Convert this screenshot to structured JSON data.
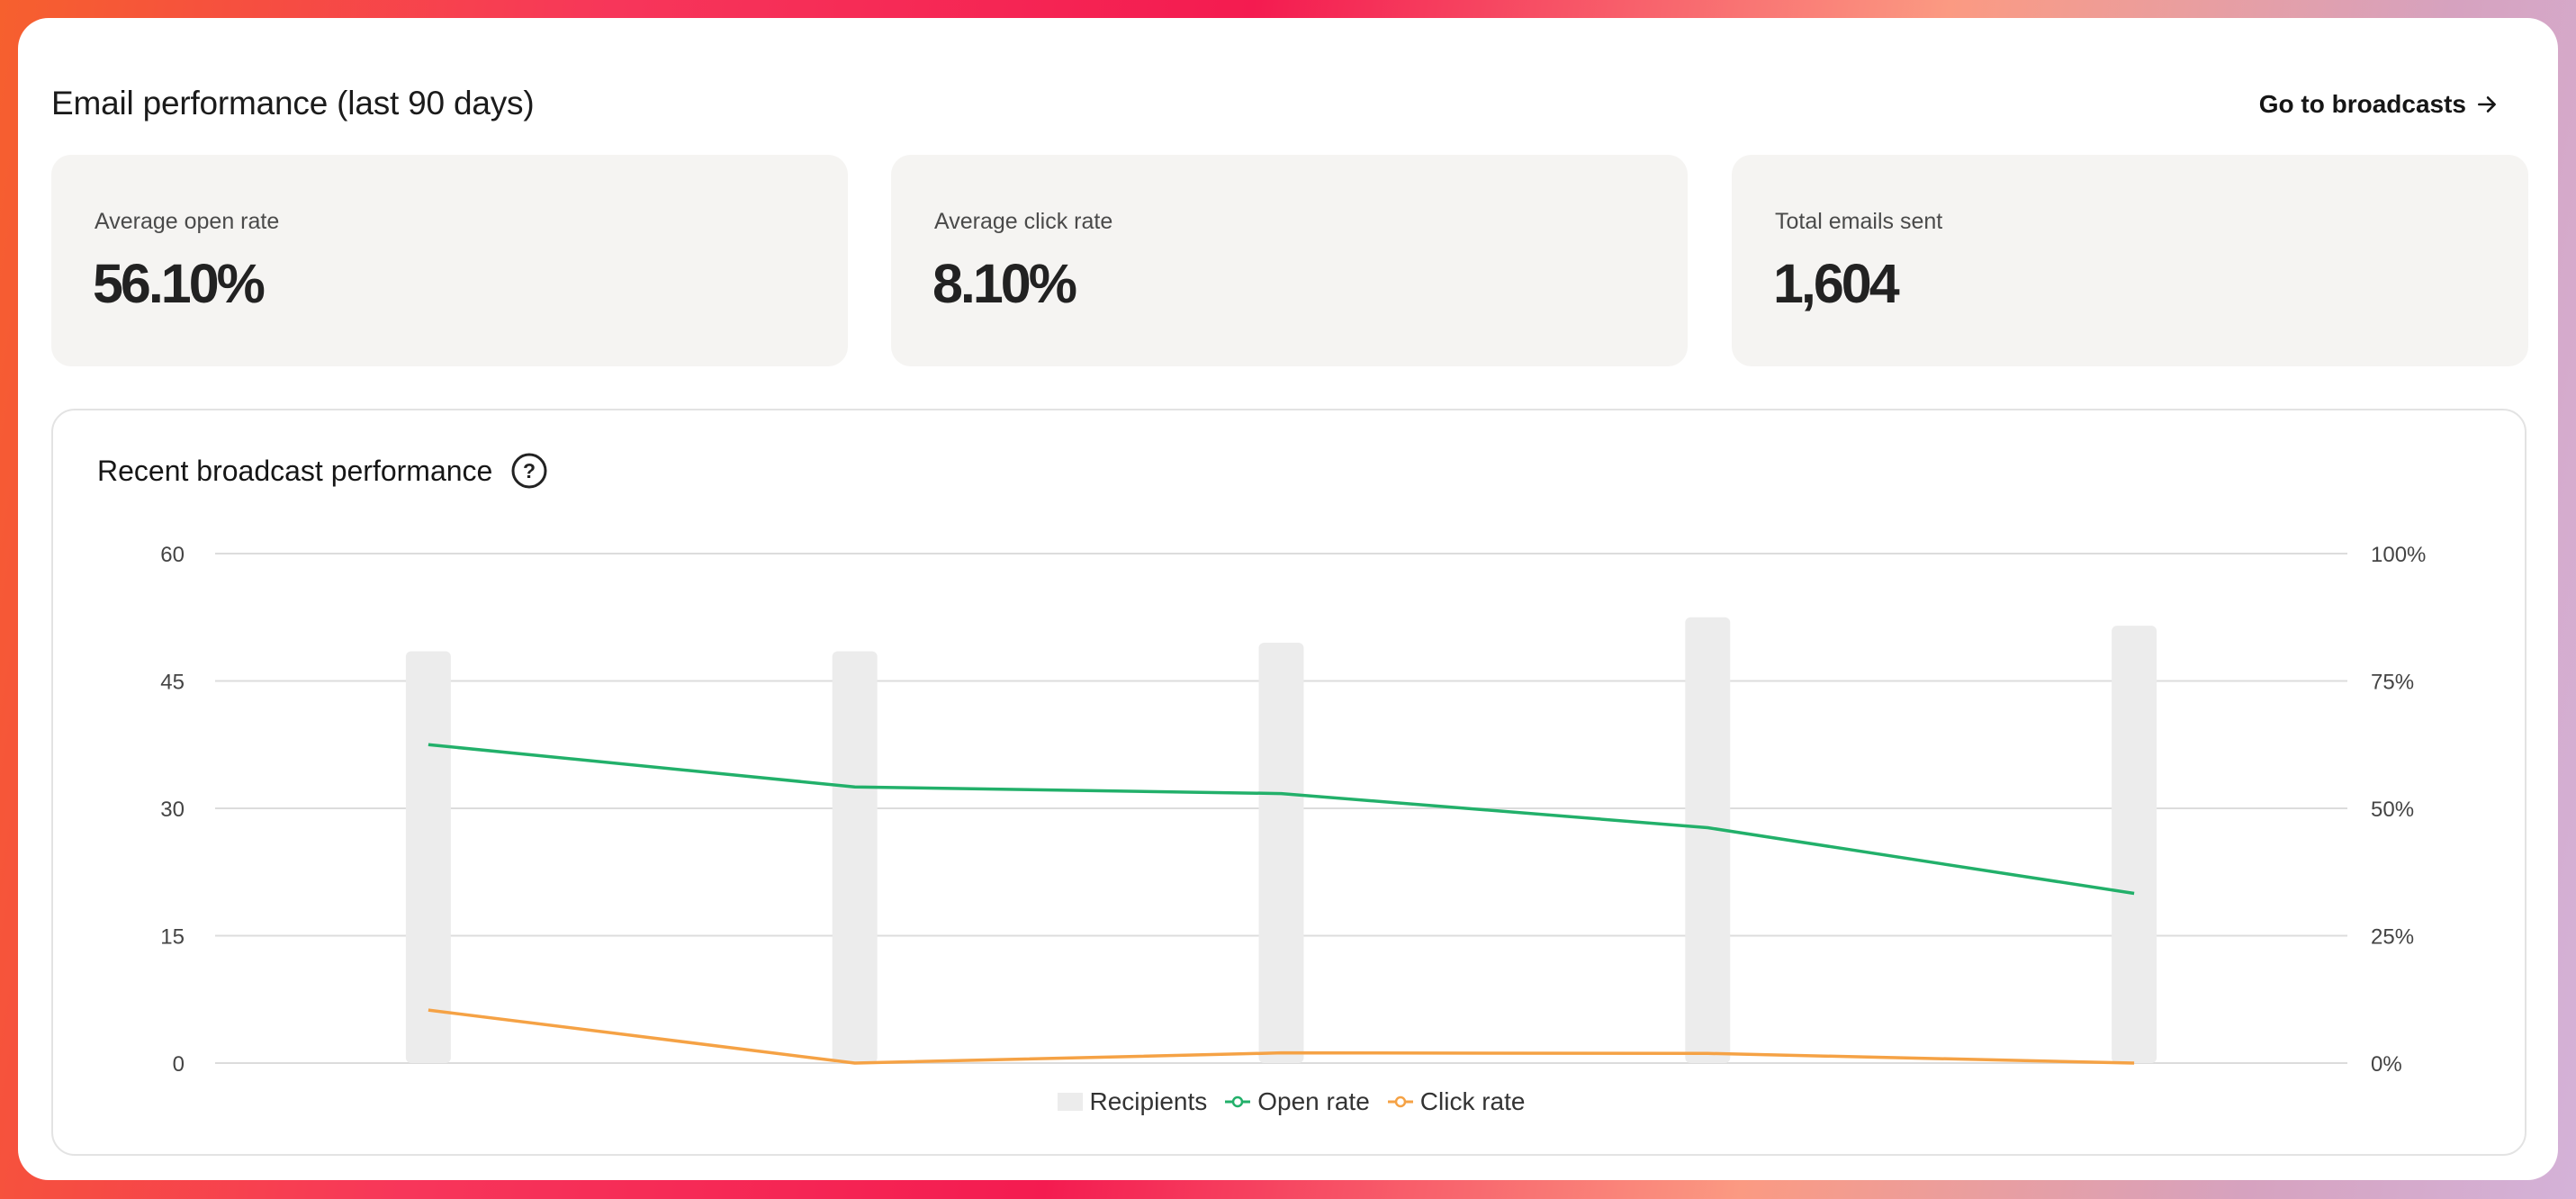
{
  "header": {
    "title": "Email performance (last 90 days)",
    "goto_label": "Go to broadcasts"
  },
  "stats": [
    {
      "label": "Average open rate",
      "value": "56.10%"
    },
    {
      "label": "Average click rate",
      "value": "8.10%"
    },
    {
      "label": "Total emails sent",
      "value": "1,604"
    }
  ],
  "chart_section": {
    "title": "Recent broadcast performance",
    "help_icon": "question-circle-icon"
  },
  "colors": {
    "open_rate": "#22b06a",
    "click_rate": "#f5a245",
    "recipients": "#ececec",
    "grid": "#dcdcdc"
  },
  "chart_data": {
    "type": "bar",
    "categories": [
      "",
      "",
      "",
      "",
      ""
    ],
    "series": [
      {
        "name": "Recipients",
        "type": "bar",
        "axis": "left",
        "values": [
          48.5,
          48.5,
          49.5,
          52.5,
          51.5
        ]
      },
      {
        "name": "Open rate",
        "type": "line",
        "axis": "right",
        "values": [
          62.5,
          54.2,
          52.9,
          46.2,
          33.3
        ]
      },
      {
        "name": "Click rate",
        "type": "line",
        "axis": "right",
        "values": [
          10.4,
          0,
          2.0,
          1.9,
          0
        ]
      }
    ],
    "ylim": [
      0,
      60
    ],
    "yticks": [
      "0",
      "15",
      "30",
      "45",
      "60"
    ],
    "y2lim": [
      0,
      100
    ],
    "y2ticks": [
      "0%",
      "25%",
      "50%",
      "75%",
      "100%"
    ],
    "grid": true,
    "legend": "bottom-center",
    "legend_labels": [
      "Recipients",
      "Open rate",
      "Click rate"
    ]
  }
}
